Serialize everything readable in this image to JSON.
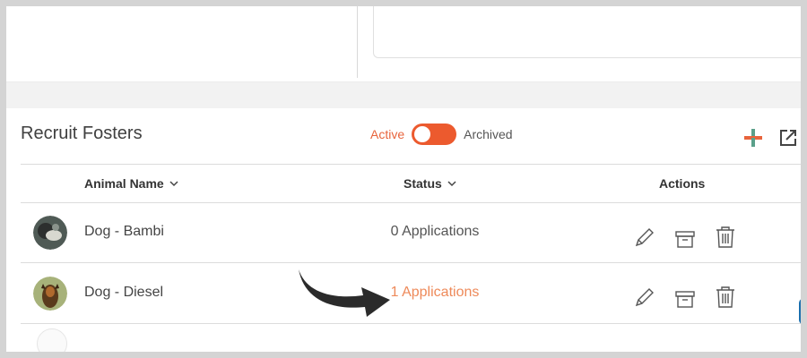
{
  "panel": {
    "title": "Recruit Fosters",
    "toggle": {
      "active_label": "Active",
      "archived_label": "Archived",
      "state": "active"
    }
  },
  "table": {
    "headers": {
      "animal_name": "Animal Name",
      "status": "Status",
      "actions": "Actions"
    },
    "rows": [
      {
        "name": "Dog - Bambi",
        "status": "0 Applications"
      },
      {
        "name": "Dog - Diesel",
        "status": "1 Applications"
      }
    ]
  },
  "icons": {
    "add": "plus-icon",
    "open_external": "external-link-icon",
    "edit": "pencil-icon",
    "archive": "archive-box-icon",
    "delete": "trash-icon",
    "sort": "chevron-down-icon"
  },
  "colors": {
    "accent": "#ec5a2e",
    "link": "#ee8a5a",
    "plus_green": "#5aa08a",
    "plus_orange": "#e8643c"
  }
}
